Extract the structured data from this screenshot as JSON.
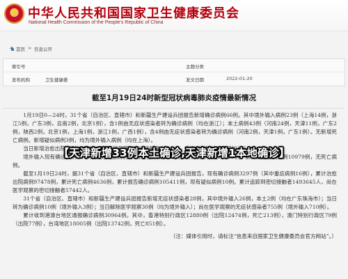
{
  "header": {
    "title": "中华人民共和国国家卫生健康委员会",
    "subtitle": "National Health Commission of the People's Republic of China"
  },
  "nav": {
    "home": "首页",
    "separator": ">",
    "section": "信息公开"
  },
  "infobox": {
    "index_label": "索引号",
    "index_value": "",
    "subject_label": "主题分类",
    "subject_value": "",
    "publisher_label": "发布机构",
    "publisher_value": "卫生健康委",
    "date_label": "发文日期",
    "date_value": "2022-01-20"
  },
  "article": {
    "title": "截至1月19日24时新型冠状病毒肺炎疫情最新情况",
    "paragraphs": [
      "1月19日0—24时，31个省（自治区、直辖市）和新疆生产建设兵团报告新增确诊病例66例。其中境外输入病例23例（上海14例，浙江5例，广东3例，云南2例，北京1例），含1例由无症状感染者转为确诊病例（均在浙江）；本土病例43例（河南24例，天津11例，广东2例，陕西2例，北京1例，上海1例，浙江1例，广西1例），含4例由无症状感染者转为确诊病例（河南2例，天津1例，广东1例）。无新增死亡病例。新增疑似病例3例，均为境外输入病例（均在上海）。",
      "当日新增治愈出院病例223例，解除医学观察的密切接触者3623人，重症病例较前一日增加1例。",
      "境外输入现有确诊病例1244例（无重症病例），现有疑似病例10例。累计确诊病例12223例，累计治愈出院病例10979例，无死亡病例。",
      "截至1月19日24时，据31个省（自治区、直辖市）和新疆生产建设兵团报告，现有确诊病例3297例（其中重症病例16例），累计治愈出院病例97478例，累计死亡病例4636例，累计报告确诊病例105411例，现有疑似病例10例。累计追踪到密切接触者1493645人，尚在医学观察的密切接触者57442人。",
      "31个省（自治区、直辖市）和新疆生产建设兵团报告新增无症状感染者28例，其中境外输入26例，本土2例（均在广东珠海市）；当日转为确诊病例10例（境外输入3例）；当日解除医学观察30例（均为境外输入）；尚在医学观察的无症状感染者755例（境外输入710例）。",
      "累计收到港澳台地区通报确诊病例30964例。其中，香港特别行政区12880例（出院12474例，死亡213例），澳门特别行政区79例（出院77例），台湾地区18005例（出院13742例，死亡851例）。"
    ],
    "note": "（注：媒体引用时，请标注“信息来自国家卫生健康委员会官方网站”。）"
  },
  "overlay": {
    "headline": "【天津新增33例本土确诊,天津新增1本地确诊】"
  }
}
